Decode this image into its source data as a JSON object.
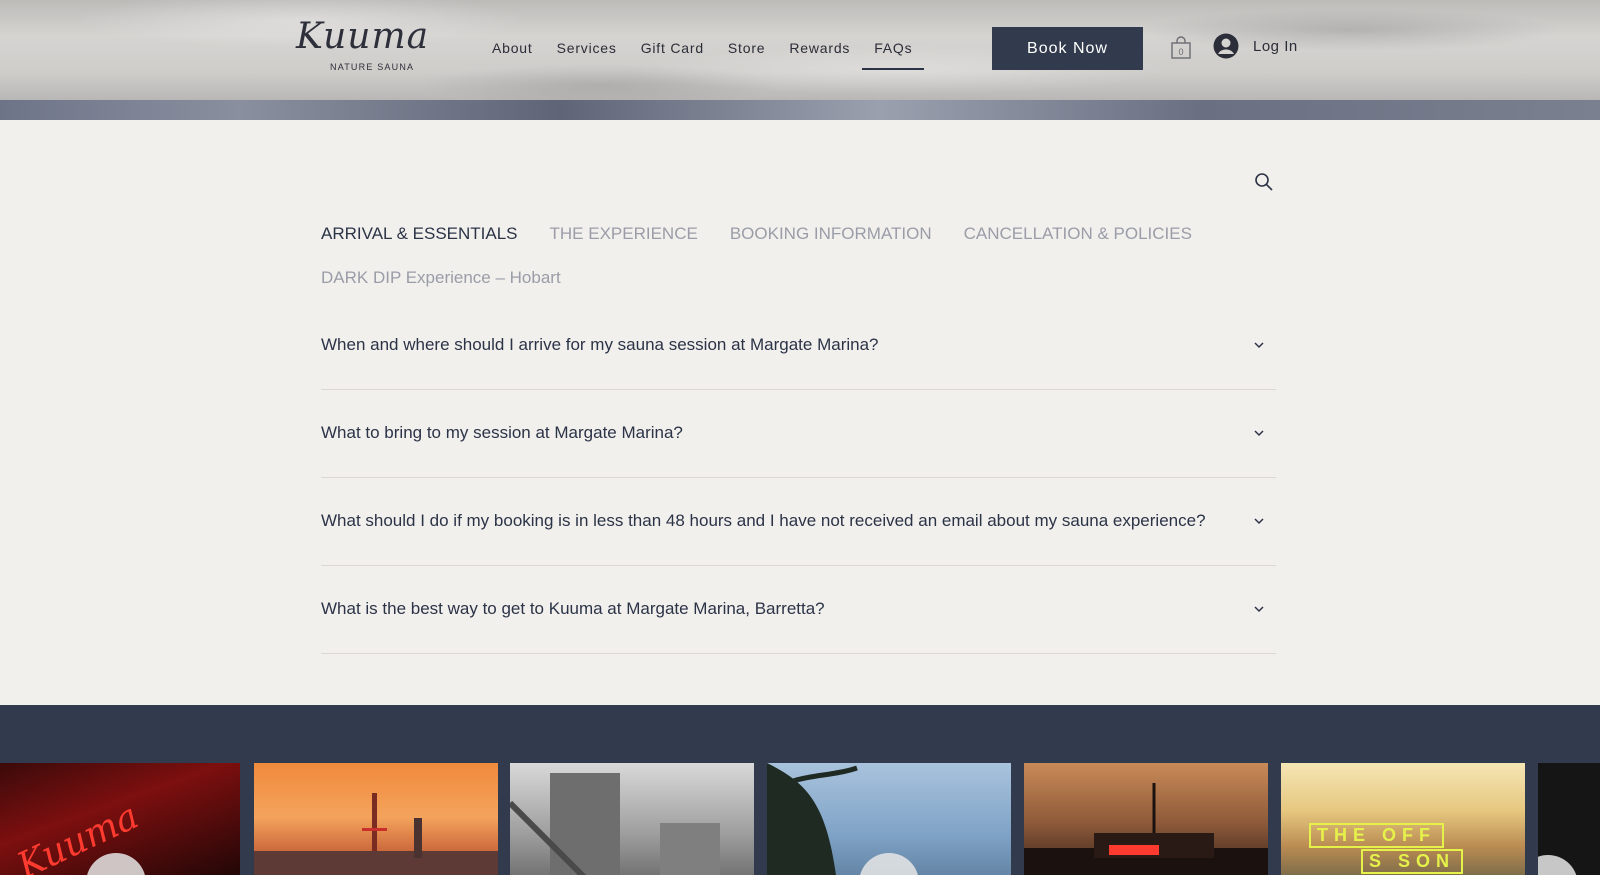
{
  "header": {
    "logo": {
      "wordmark": "Kuuma",
      "subtitle": "NATURE SAUNA"
    },
    "nav": [
      {
        "label": "About"
      },
      {
        "label": "Services"
      },
      {
        "label": "Gift Card"
      },
      {
        "label": "Store"
      },
      {
        "label": "Rewards"
      },
      {
        "label": "FAQs",
        "active": true
      }
    ],
    "book_label": "Book Now",
    "cart_count": "0",
    "login_label": "Log In"
  },
  "faq": {
    "tabs": [
      {
        "label": "ARRIVAL & ESSENTIALS",
        "active": true
      },
      {
        "label": "THE EXPERIENCE"
      },
      {
        "label": "BOOKING INFORMATION"
      },
      {
        "label": "CANCELLATION & POLICIES"
      }
    ],
    "category_title": "DARK DIP Experience – Hobart",
    "questions": [
      "When and where should I arrive for my sauna session at Margate Marina?",
      "What to bring to my session at Margate Marina?",
      "What should I do if my booking is in less than 48 hours and I have not received an email about my sauna experience?",
      "What is the best way to get to Kuuma at Margate Marina, Barretta?"
    ]
  },
  "gallery": {
    "neon_text": "Kuuma",
    "promo_line1": "THE OFF",
    "promo_line2": "S  SON"
  },
  "colors": {
    "primary": "#323b4d",
    "background": "#f2f0ed",
    "muted_text": "#9a9da8",
    "accent_neon": "#e5f24a"
  }
}
